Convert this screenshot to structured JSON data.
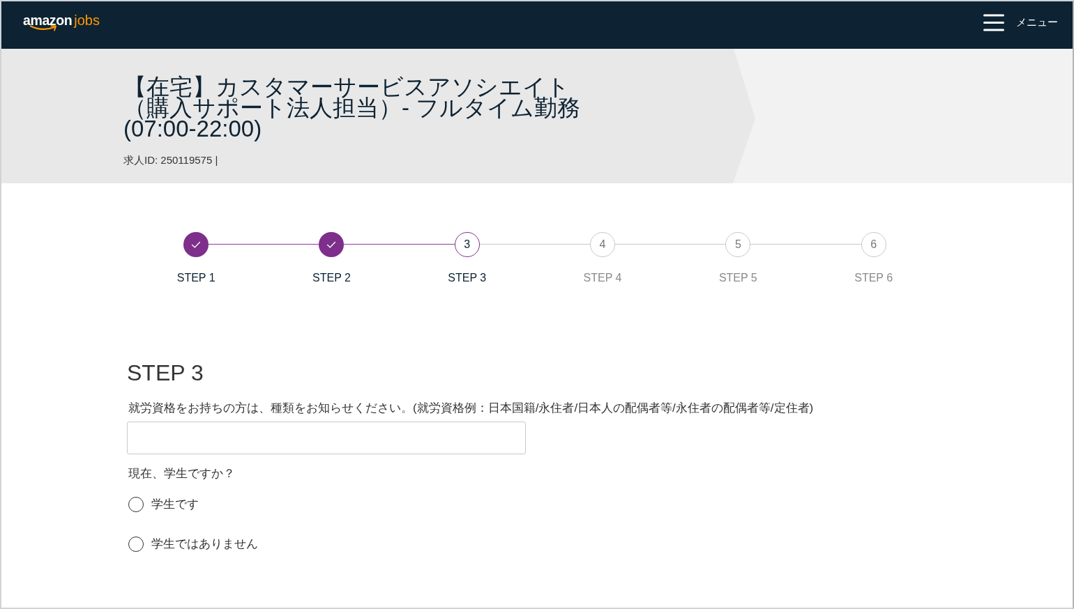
{
  "header": {
    "logo": {
      "brand": "amazon",
      "product": "jobs"
    },
    "menu": {
      "label": "メニュー"
    }
  },
  "job": {
    "title": "【在宅】カスタマーサービスアソシエイト（購入サポート法人担当）- フルタイム勤務(07:00-22:00)",
    "id_line": "求人ID: 250119575 |"
  },
  "stepper": {
    "steps": [
      {
        "label": "STEP 1",
        "completed": true,
        "selected": false
      },
      {
        "label": "STEP 2",
        "completed": true,
        "selected": false
      },
      {
        "label": "STEP 3",
        "number": "3",
        "completed": false,
        "selected": true
      },
      {
        "label": "STEP 4",
        "number": "4",
        "completed": false,
        "selected": false
      },
      {
        "label": "STEP 5",
        "number": "5",
        "completed": false,
        "selected": false
      },
      {
        "label": "STEP 6",
        "number": "6",
        "completed": false,
        "selected": false
      }
    ]
  },
  "form": {
    "heading": "STEP 3",
    "fields": [
      {
        "kind": "text",
        "label": "就労資格をお持ちの方は、種類をお知らせください。(就労資格例：日本国籍/永住者/日本人の配偶者等/永住者の配偶者等/定住者)"
      },
      {
        "kind": "radio",
        "label": "現在、学生ですか？",
        "options": [
          {
            "label": "学生です",
            "selected": false
          },
          {
            "label": "学生ではありません",
            "selected": false
          }
        ]
      }
    ]
  }
}
